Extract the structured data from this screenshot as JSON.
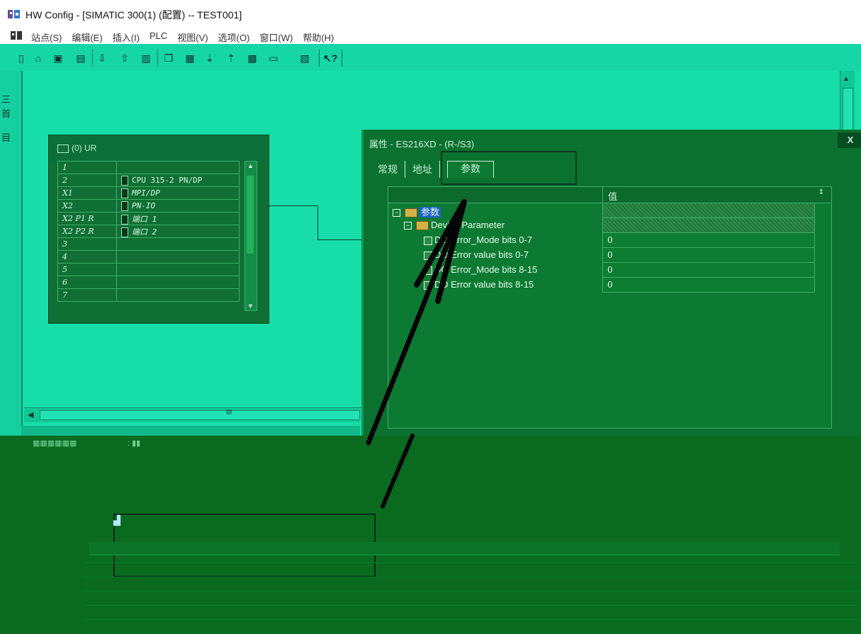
{
  "window": {
    "title": "HW Config - [SIMATIC 300(1) (配置) -- TEST001]"
  },
  "menubar": {
    "items": [
      "站点(S)",
      "编辑(E)",
      "插入(I)",
      "PLC",
      "视图(V)",
      "选项(O)",
      "窗口(W)",
      "帮助(H)"
    ]
  },
  "toolbar": {
    "icons": [
      "new-icon",
      "open-icon",
      "save-icon",
      "save-compile-icon",
      "download-icon",
      "upload-icon",
      "print-icon",
      "copy-icon",
      "paste-icon",
      "download-module-icon",
      "upload-module-icon",
      "hardware-catalog-icon",
      "network-view-icon",
      "diagnostics-icon",
      "help-icon"
    ],
    "help_glyph": "?"
  },
  "left_strip": {
    "items": [
      "三",
      "首",
      "目"
    ]
  },
  "rack": {
    "title": "(0) UR",
    "rows": [
      {
        "slot": "1",
        "module": ""
      },
      {
        "slot": "2",
        "module": "CPU 315-2 PN/DP"
      },
      {
        "slot": "X1",
        "module": "MPI/DP"
      },
      {
        "slot": "X2",
        "module": "PN-IO"
      },
      {
        "slot": "X2 P1 R",
        "module": "端口 1"
      },
      {
        "slot": "X2 P2 R",
        "module": "端口 2"
      },
      {
        "slot": "3",
        "module": ""
      },
      {
        "slot": "4",
        "module": ""
      },
      {
        "slot": "5",
        "module": ""
      },
      {
        "slot": "6",
        "module": ""
      },
      {
        "slot": "7",
        "module": ""
      }
    ]
  },
  "hscroll": {
    "grip": "III"
  },
  "dialog": {
    "title": "属性 - ES216XD - (R-/S3)",
    "close": "X",
    "tabs": [
      "常规",
      "地址",
      "参数"
    ],
    "active_tab": "参数",
    "column_value": "值",
    "tree": {
      "root": "参数",
      "group": "Device Parameter",
      "params": [
        {
          "name": "DO Error_Mode bits 0-7",
          "value": "0"
        },
        {
          "name": "DO Error value bits 0-7",
          "value": "0"
        },
        {
          "name": "DO Error_Mode bits 8-15",
          "value": "0"
        },
        {
          "name": "DO Error value bits 8-15",
          "value": "0"
        }
      ]
    }
  },
  "colors": {
    "workspace": "#17dda8",
    "dialog": "#0b7130",
    "selection": "#1f5fd0"
  }
}
